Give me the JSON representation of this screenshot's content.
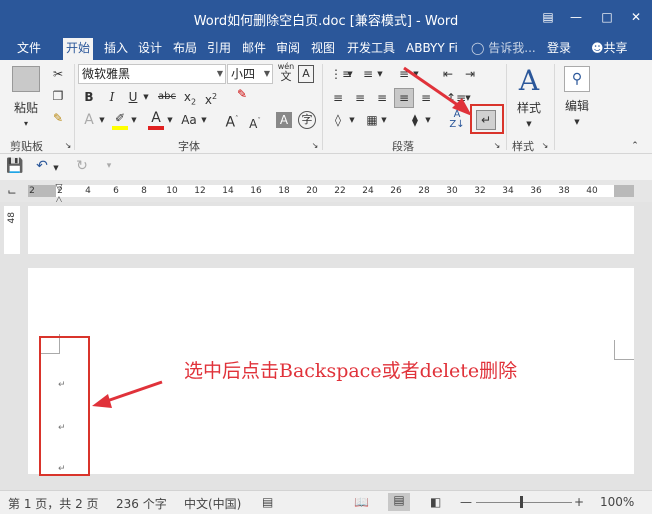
{
  "window": {
    "title": "Word如何删除空白页.doc [兼容模式] - Word"
  },
  "tabs": [
    "文件",
    "开始",
    "插入",
    "设计",
    "布局",
    "引用",
    "邮件",
    "审阅",
    "视图",
    "开发工具",
    "ABBYY Fi"
  ],
  "tell_me": "告诉我...",
  "login": "登录",
  "share": "共享",
  "clipboard": {
    "paste": "粘贴",
    "group": "剪贴板"
  },
  "font": {
    "name": "微软雅黑",
    "size": "小四",
    "group": "字体",
    "wen": "wén",
    "wen_char": "文"
  },
  "paragraph": {
    "group": "段落"
  },
  "styles": {
    "label": "样式",
    "group": "样式"
  },
  "editing": {
    "label": "编辑"
  },
  "ruler": {
    "marks": [
      "2",
      "2",
      "4",
      "6",
      "8",
      "10",
      "12",
      "14",
      "16",
      "18",
      "20",
      "22",
      "24",
      "26",
      "28",
      "30",
      "32",
      "34",
      "36",
      "38",
      "40"
    ]
  },
  "vruler": {
    "label": "48"
  },
  "annotation": "选中后点击Backspace或者delete删除",
  "status": {
    "page": "第 1 页，共 2 页",
    "words": "236 个字",
    "lang": "中文(中国)",
    "zoom": "100%"
  },
  "colors": {
    "brand": "#2b579a",
    "highlight": "#d9342b"
  }
}
